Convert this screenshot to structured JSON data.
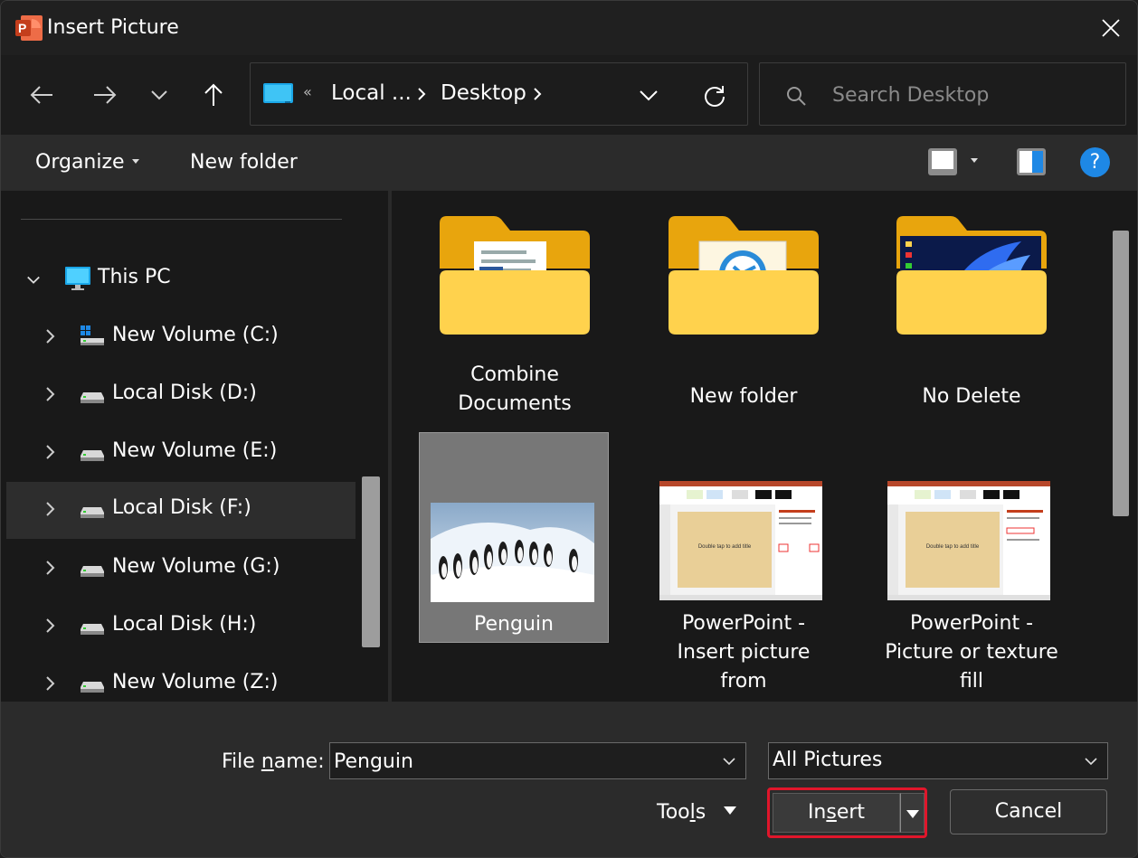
{
  "window": {
    "title": "Insert Picture",
    "app_icon": "powerpoint-icon",
    "close_icon": "close-icon"
  },
  "nav": {
    "back_icon": "back-arrow-icon",
    "forward_icon": "forward-arrow-icon",
    "recent_icon": "chevron-down-icon",
    "up_icon": "up-arrow-icon"
  },
  "address": {
    "overflow": "«",
    "crumbs": [
      "Local ...",
      "Desktop"
    ],
    "refresh_icon": "refresh-icon"
  },
  "search": {
    "placeholder": "Search Desktop"
  },
  "toolbar": {
    "organize_label": "Organize",
    "new_folder_label": "New folder",
    "view_icon": "view-mode-icon",
    "preview_pane_icon": "preview-pane-icon",
    "help_label": "?"
  },
  "sidebar": {
    "root": {
      "label": "This PC",
      "icon": "this-pc-icon"
    },
    "drives": [
      {
        "label": "New Volume (C:)",
        "icon": "system-drive-icon"
      },
      {
        "label": "Local Disk (D:)",
        "icon": "drive-icon"
      },
      {
        "label": "New Volume (E:)",
        "icon": "drive-icon"
      },
      {
        "label": "Local Disk (F:)",
        "icon": "drive-icon",
        "selected": true
      },
      {
        "label": "New Volume (G:)",
        "icon": "drive-icon"
      },
      {
        "label": "Local Disk (H:)",
        "icon": "drive-icon"
      },
      {
        "label": "New Volume (Z:)",
        "icon": "drive-icon"
      }
    ]
  },
  "files": [
    {
      "label_lines": [
        "Combine",
        "Documents"
      ],
      "type": "folder"
    },
    {
      "label_lines": [
        "New folder"
      ],
      "type": "folder"
    },
    {
      "label_lines": [
        "No Delete"
      ],
      "type": "folder"
    },
    {
      "label_lines": [
        "Penguin"
      ],
      "type": "image",
      "selected": true
    },
    {
      "label_lines": [
        "PowerPoint -",
        "Insert picture",
        "from"
      ],
      "type": "image"
    },
    {
      "label_lines": [
        "PowerPoint -",
        "Picture or texture",
        "fill"
      ],
      "type": "image"
    }
  ],
  "thumbnails": {
    "slide_placeholder": "Double tap to add title"
  },
  "footer": {
    "file_name_label_pre": "File ",
    "file_name_label_ul": "n",
    "file_name_label_post": "ame:",
    "file_name_value": "Penguin",
    "filter_value": "All Pictures",
    "tools_pre": "Too",
    "tools_ul": "l",
    "tools_post": "s",
    "insert_pre": "In",
    "insert_ul": "s",
    "insert_post": "ert",
    "cancel_label": "Cancel"
  },
  "colors": {
    "highlight_border": "#e0162b",
    "help_blue": "#1e88e5",
    "folder_yellow": "#f7c948"
  }
}
